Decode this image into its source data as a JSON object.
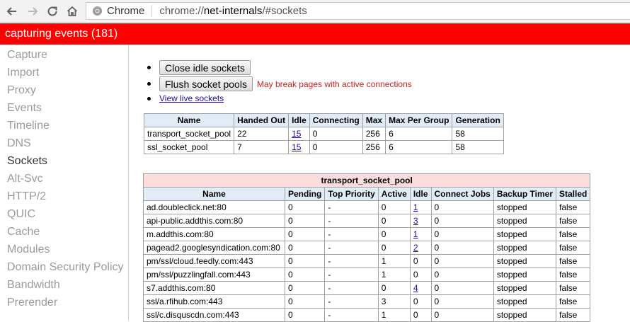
{
  "browser": {
    "badge_label": "Chrome",
    "url_scheme": "chrome://",
    "url_host": "net-internals",
    "url_path": "/#sockets"
  },
  "capture_bar": {
    "text": "capturing events (181)"
  },
  "sidebar": {
    "items": [
      {
        "label": "Capture"
      },
      {
        "label": "Import"
      },
      {
        "label": "Proxy"
      },
      {
        "label": "Events"
      },
      {
        "label": "Timeline"
      },
      {
        "label": "DNS"
      },
      {
        "label": "Sockets"
      },
      {
        "label": "Alt-Svc"
      },
      {
        "label": "HTTP/2"
      },
      {
        "label": "QUIC"
      },
      {
        "label": "Cache"
      },
      {
        "label": "Modules"
      },
      {
        "label": "Domain Security Policy"
      },
      {
        "label": "Bandwidth"
      },
      {
        "label": "Prerender"
      }
    ],
    "active": "Sockets"
  },
  "actions": {
    "close_idle_label": "Close idle sockets",
    "flush_label": "Flush socket pools",
    "flush_warning": "May break pages with active connections",
    "view_live_label": "View live sockets"
  },
  "pools_table": {
    "headers": [
      "Name",
      "Handed Out",
      "Idle",
      "Connecting",
      "Max",
      "Max Per Group",
      "Generation"
    ],
    "rows": [
      [
        "transport_socket_pool",
        "22",
        "15",
        "0",
        "256",
        "6",
        "58"
      ],
      [
        "ssl_socket_pool",
        "7",
        "15",
        "0",
        "256",
        "6",
        "58"
      ]
    ]
  },
  "transport_table": {
    "title": "transport_socket_pool",
    "headers": [
      "Name",
      "Pending",
      "Top Priority",
      "Active",
      "Idle",
      "Connect Jobs",
      "Backup Timer",
      "Stalled"
    ],
    "rows": [
      [
        "ad.doubleclick.net:80",
        "0",
        "-",
        "0",
        "1",
        "0",
        "stopped",
        "false"
      ],
      [
        "api-public.addthis.com:80",
        "0",
        "-",
        "0",
        "3",
        "0",
        "stopped",
        "false"
      ],
      [
        "m.addthis.com:80",
        "0",
        "-",
        "0",
        "1",
        "0",
        "stopped",
        "false"
      ],
      [
        "pagead2.googlesyndication.com:80",
        "0",
        "-",
        "0",
        "2",
        "0",
        "stopped",
        "false"
      ],
      [
        "pm/ssl/cloud.feedly.com:443",
        "0",
        "-",
        "1",
        "0",
        "0",
        "stopped",
        "false"
      ],
      [
        "pm/ssl/puzzlingfall.com:443",
        "0",
        "-",
        "1",
        "0",
        "0",
        "stopped",
        "false"
      ],
      [
        "s7.addthis.com:80",
        "0",
        "-",
        "0",
        "4",
        "0",
        "stopped",
        "false"
      ],
      [
        "ssl/a.rfihub.com:443",
        "0",
        "-",
        "3",
        "0",
        "0",
        "stopped",
        "false"
      ],
      [
        "ssl/c.disquscdn.com:443",
        "0",
        "-",
        "1",
        "0",
        "0",
        "stopped",
        "false"
      ]
    ]
  },
  "colors": {
    "capture_bar": "#ff0000",
    "header_bg": "#e1ecf7",
    "title_bg": "#fcdcdc",
    "link": "#1a0dab"
  }
}
